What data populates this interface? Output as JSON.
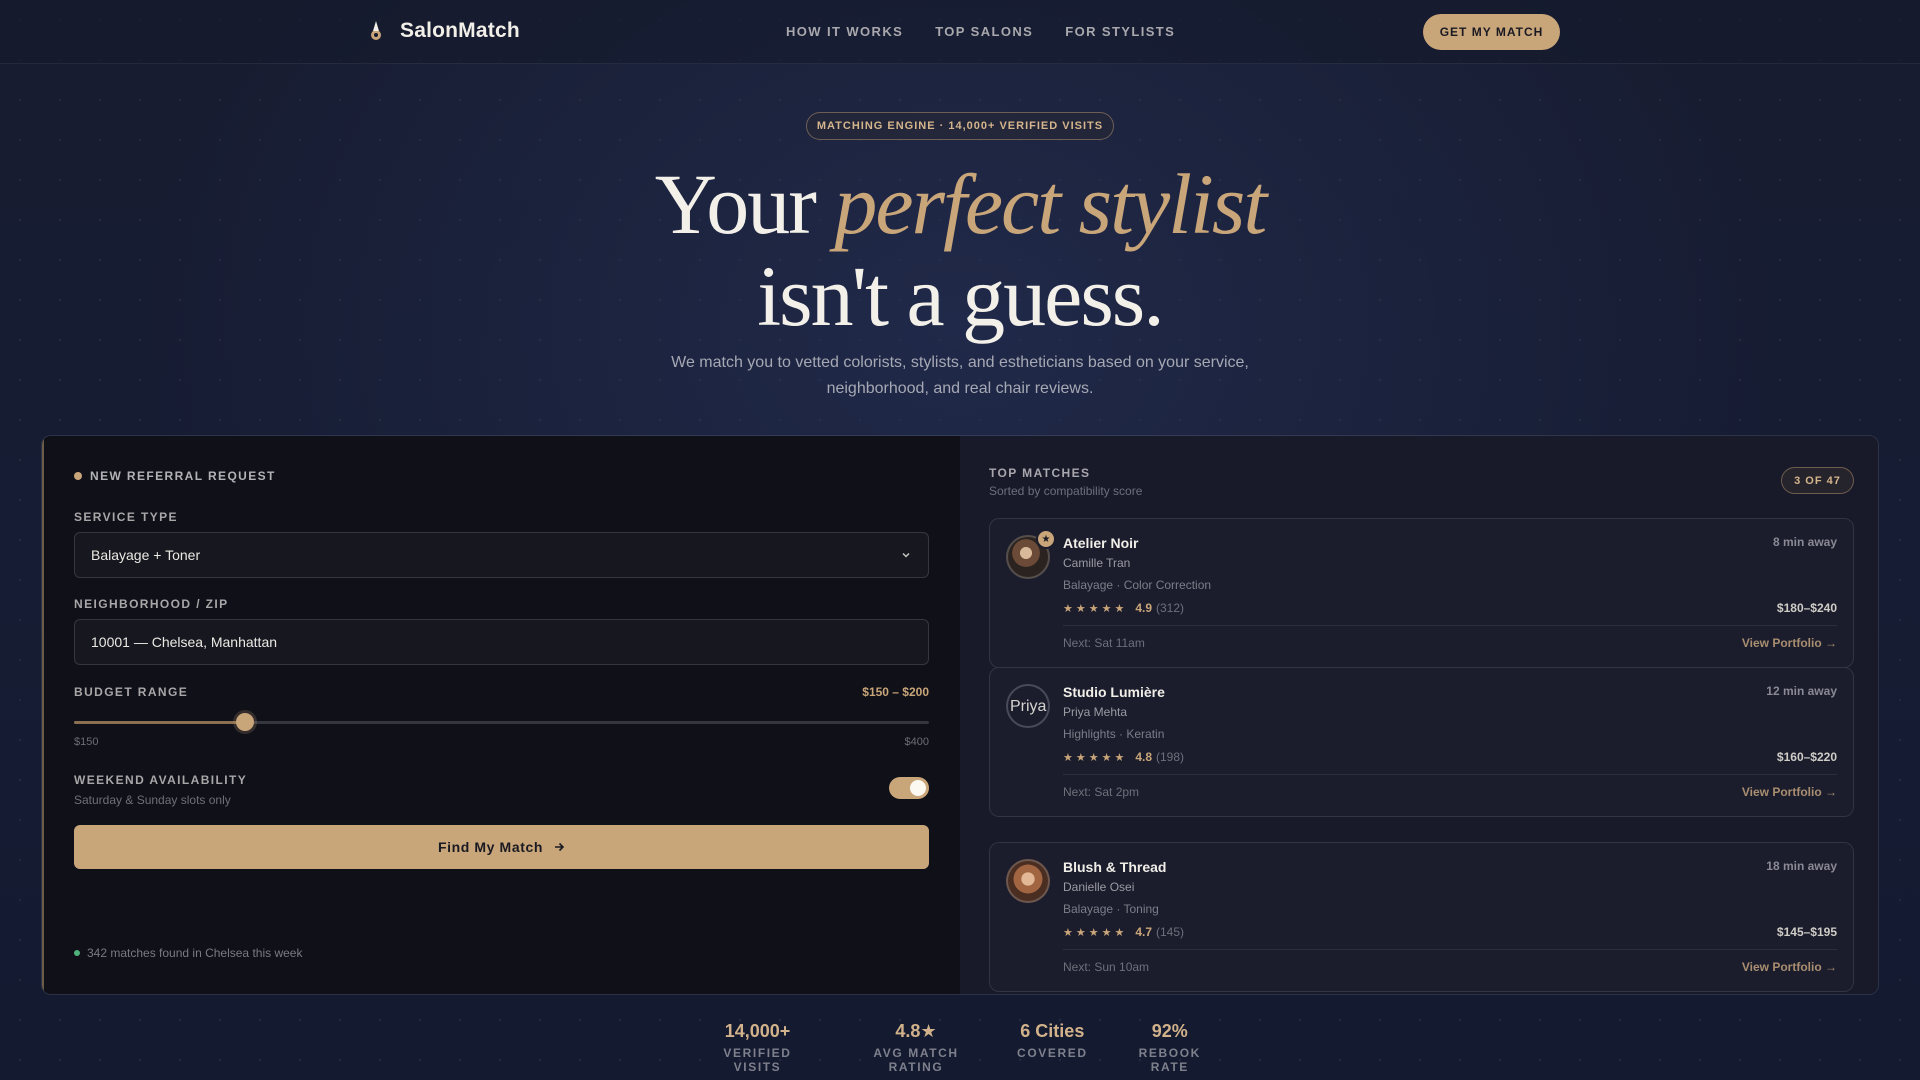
{
  "nav": {
    "brand": "SalonMatch",
    "links": [
      "HOW IT WORKS",
      "TOP SALONS",
      "FOR STYLISTS"
    ],
    "cta": "GET MY MATCH"
  },
  "hero": {
    "pill": "MATCHING ENGINE · 14,000+ VERIFIED VISITS",
    "title_a": "Your ",
    "title_accent": "perfect stylist",
    "title_b": "isn't a guess.",
    "subtitle": "We match you to vetted colorists, stylists, and estheticians based on your service, neighborhood, and real chair reviews."
  },
  "form": {
    "heading": "NEW REFERRAL REQUEST",
    "service_label": "SERVICE TYPE",
    "service_value": "Balayage + Toner",
    "zip_label": "NEIGHBORHOOD / ZIP",
    "zip_value": "10001 — Chelsea, Manhattan",
    "budget_label": "BUDGET RANGE",
    "budget_value": "$150 – $200",
    "budget_min_label": "$150",
    "budget_max_label": "$400",
    "budget_slider_fraction": 0.2,
    "weekend_label": "WEEKEND AVAILABILITY",
    "weekend_sub": "Saturday & Sunday slots only",
    "weekend_on": true,
    "cta": "Find My Match",
    "footnote": "342 matches found in Chelsea this week"
  },
  "matches": {
    "title": "TOP MATCHES",
    "subtitle": "Sorted by compatibility score",
    "count": "3 OF 47",
    "cards": [
      {
        "salon": "Atelier Noir",
        "stylist": "Camille Tran",
        "tags": "Balayage · Color Correction",
        "rating": "4.9",
        "reviews": "(312)",
        "distance": "8 min away",
        "price": "$180–$240",
        "next": "Next: Sat 11am",
        "link": "View Portfolio →",
        "featured": true
      },
      {
        "salon": "Studio Lumière",
        "stylist": "Priya Mehta",
        "tags": "Highlights · Keratin",
        "rating": "4.8",
        "reviews": "(198)",
        "distance": "12 min away",
        "price": "$160–$220",
        "next": "Next: Sat 2pm",
        "link": "View Portfolio →",
        "avatar_alt": "Priya"
      },
      {
        "salon": "Blush & Thread",
        "stylist": "Danielle Osei",
        "tags": "Balayage · Toning",
        "rating": "4.7",
        "reviews": "(145)",
        "distance": "18 min away",
        "price": "$145–$195",
        "next": "Next: Sun 10am",
        "link": "View Portfolio →"
      }
    ]
  },
  "stats": [
    {
      "value": "14,000+",
      "label": "VERIFIED VISITS"
    },
    {
      "value": "4.8★",
      "label": "AVG MATCH RATING"
    },
    {
      "value": "6 Cities",
      "label": "COVERED"
    },
    {
      "value": "92%",
      "label": "REBOOK RATE"
    }
  ],
  "colors": {
    "accent": "#c9a57a",
    "background": "#161c33",
    "panel_left": "#0f1018",
    "panel_right": "#181a2a",
    "online": "#4fb37b"
  }
}
